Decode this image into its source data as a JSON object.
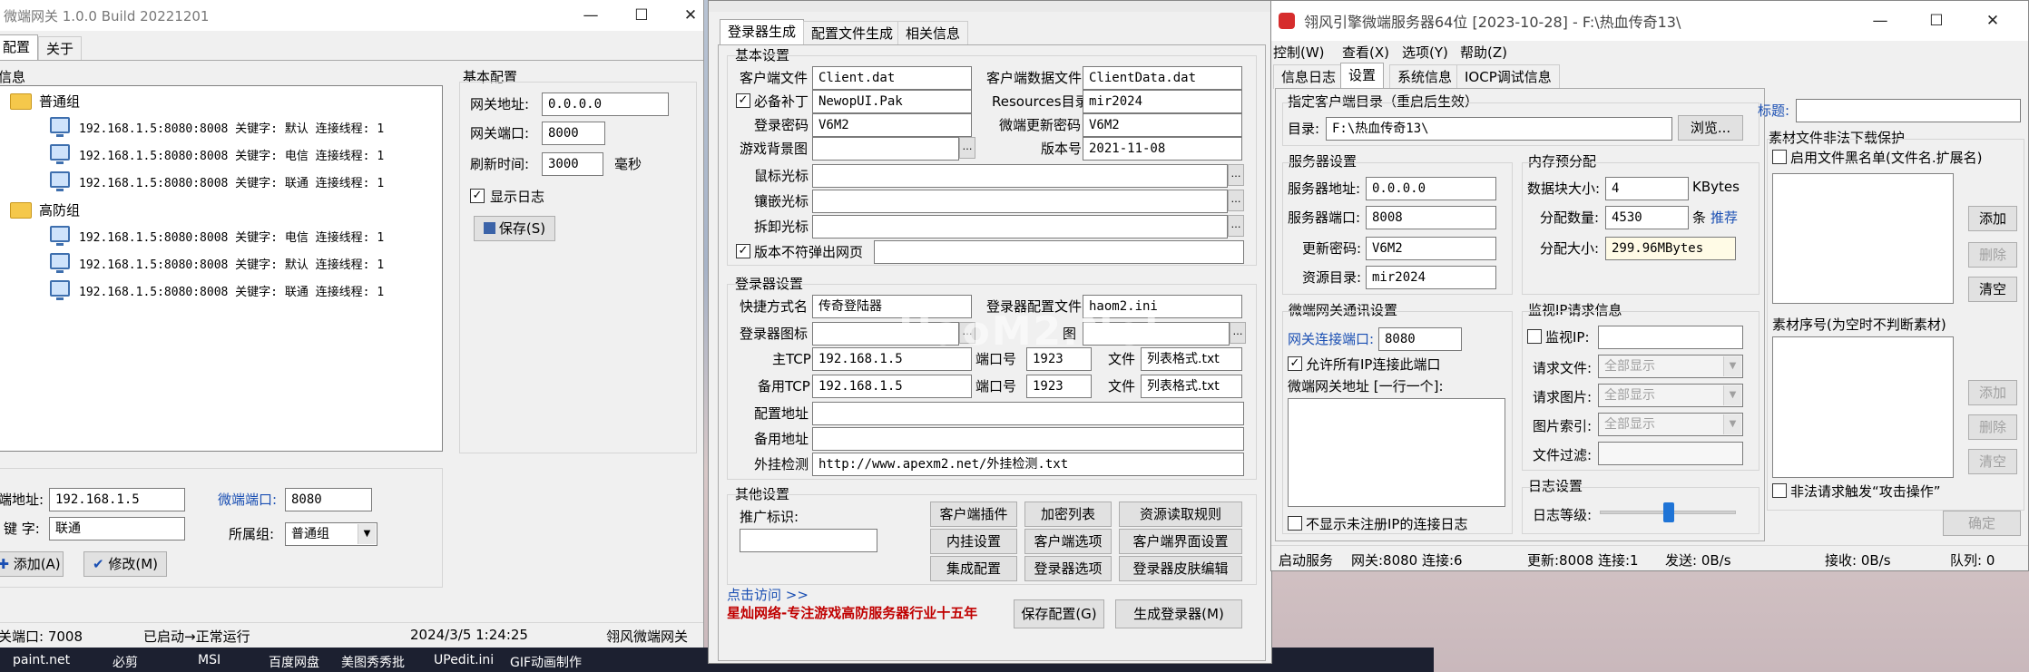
{
  "w1": {
    "title": "微端网关 1.0.0 Build 20221201",
    "menu": [
      "配置",
      "关于"
    ],
    "info_label": "信息",
    "groups": [
      {
        "name": "普通组",
        "rows": [
          "192.168.1.5:8080:8008 关键字: 默认 连接线程: 1",
          "192.168.1.5:8080:8008 关键字: 电信 连接线程: 1",
          "192.168.1.5:8080:8008 关键字: 联通 连接线程: 1"
        ]
      },
      {
        "name": "高防组",
        "rows": [
          "192.168.1.5:8080:8008 关键字: 电信 连接线程: 1",
          "192.168.1.5:8080:8008 关键字: 默认 连接线程: 1",
          "192.168.1.5:8080:8008 关键字: 联通 连接线程: 1"
        ]
      }
    ],
    "basic_title": "基本配置",
    "gw_addr_label": "网关地址:",
    "gw_addr": "0.0.0.0",
    "gw_port_label": "网关端口:",
    "gw_port": "8000",
    "refresh_label": "刷新时间:",
    "refresh": "3000",
    "refresh_unit": "毫秒",
    "showlog": "显示日志",
    "save": "保存(S)",
    "srv_addr_label": "端地址:",
    "srv_addr": "192.168.1.5",
    "wd_port_label": "微端端口:",
    "wd_port": "8080",
    "key_label": "键 字:",
    "key": "联通",
    "grp_label": "所属组:",
    "grp": "普通组",
    "add": "添加(A)",
    "modify": "修改(M)",
    "status": [
      "关端口: 7008",
      "已启动→正常运行",
      "2024/3/5 1:24:25",
      "翎风微端网关"
    ]
  },
  "w2": {
    "tabs": [
      "登录器生成",
      "配置文件生成",
      "相关信息"
    ],
    "basic": "基本设置",
    "client_file_label": "客户端文件",
    "client_file": "Client.dat",
    "client_data_label": "客户端数据文件",
    "client_data": "ClientData.dat",
    "patch_label": "必备补丁",
    "patch": "NewopUI.Pak",
    "res_label": "Resources目录",
    "res": "mir2024",
    "pwd_label": "登录密码",
    "pwd": "V6M2",
    "upd_pwd_label": "微端更新密码",
    "upd_pwd": "V6M2",
    "bg_label": "游戏背景图",
    "ver_label": "版本号",
    "ver": "2021-11-08",
    "cursor_label": "鼠标光标",
    "inlay_label": "镶嵌光标",
    "remove_label": "拆卸光标",
    "nopop_label": "版本不符弹出网页",
    "login_set": "登录器设置",
    "shortcut_label": "快捷方式名",
    "shortcut": "传奇登陆器",
    "cfgfile_label": "登录器配置文件",
    "cfgfile": "haom2.ini",
    "icon_label": "登录器图标",
    "icon_label2": "图",
    "main_tcp_label": "主TCP",
    "main_tcp": "192.168.1.5",
    "port_label": "端口号",
    "port1": "1923",
    "port2": "1923",
    "file_label": "文件",
    "file1": "列表格式.txt",
    "file2": "列表格式.txt",
    "bak_tcp_label": "备用TCP",
    "bak_tcp": "192.168.1.5",
    "cfg_addr_label": "配置地址",
    "bak_addr_label": "备用地址",
    "plugin_label": "外挂检测",
    "plugin": "http://www.apexm2.net/外挂检测.txt",
    "other": "其他设置",
    "promo_label": "推广标识:",
    "btns": [
      "客户端插件",
      "加密列表",
      "资源读取规则",
      "内挂设置",
      "客户端选项",
      "客户端界面设置",
      "集成配置",
      "登录器选项",
      "登录器皮肤编辑"
    ],
    "visit": "点击访问 >>",
    "brand": "星灿网络-专注游戏高防服务器行业十五年",
    "save_cfg": "保存配置(G)",
    "gen": "生成登录器(M)"
  },
  "w3": {
    "title": "翎风引擎微端服务器64位 [2023-10-28] - F:\\热血传奇13\\",
    "menu": [
      "控制(W)",
      "查看(X)",
      "选项(Y)",
      "帮助(Z)"
    ],
    "tabs": [
      "信息日志",
      "设置",
      "系统信息",
      "IOCP调试信息"
    ],
    "dir_title": "指定客户端目录（重启后生效）",
    "dir_label": "目录:",
    "dir": "F:\\热血传奇13\\",
    "browse": "浏览...",
    "srv_title": "服务器设置",
    "srv_addr_label": "服务器地址:",
    "srv_addr": "0.0.0.0",
    "srv_port_label": "服务器端口:",
    "srv_port": "8008",
    "upd_pwd_label": "更新密码:",
    "upd_pwd": "V6M2",
    "res_label": "资源目录:",
    "res": "mir2024",
    "mem_title": "内存预分配",
    "blk_label": "数据块大小:",
    "blk": "4",
    "blk_unit": "KBytes",
    "cnt_label": "分配数量:",
    "cnt": "4530",
    "cnt_unit": "条",
    "rec": "推荐",
    "size_label": "分配大小:",
    "size": "299.96MBytes",
    "comm_title": "微端网关通讯设置",
    "conn_port_label": "网关连接端口:",
    "conn_port": "8080",
    "allow_ip": "允许所有IP连接此端口",
    "gw_addr_label": "微端网关地址 [一行一个]:",
    "no_unreg": "不显示未注册IP的连接日志",
    "mon_title": "监视IP请求信息",
    "mon_ip": "监视IP:",
    "req_file": "请求文件:",
    "req_img": "请求图片:",
    "img_idx": "图片索引:",
    "file_filter": "文件过滤:",
    "all": "全部显示",
    "log_title": "日志设置",
    "log_level": "日志等级:",
    "log_level_value": 0.5,
    "caption_label": "标题:",
    "protect_title": "素材文件非法下载保护",
    "blacklist": "启用文件黑名单(文件名.扩展名)",
    "add": "添加",
    "del": "删除",
    "clear": "清空",
    "seq_title": "素材序号(为空时不判断素材)",
    "attack": "非法请求触发“攻击操作”",
    "ok": "确定",
    "status": [
      "启动服务",
      "网关:8080 连接:6",
      "更新:8008 连接:1",
      "发送: 0B/s",
      "接收: 0B/s",
      "队列: 0"
    ]
  },
  "taskbar": [
    "paint.net",
    "必剪",
    "MSI",
    "百度网盘",
    "美图秀秀批",
    "UPedit.ini",
    "GIF动画制作"
  ],
  "watermark": "HaoM2.Net"
}
